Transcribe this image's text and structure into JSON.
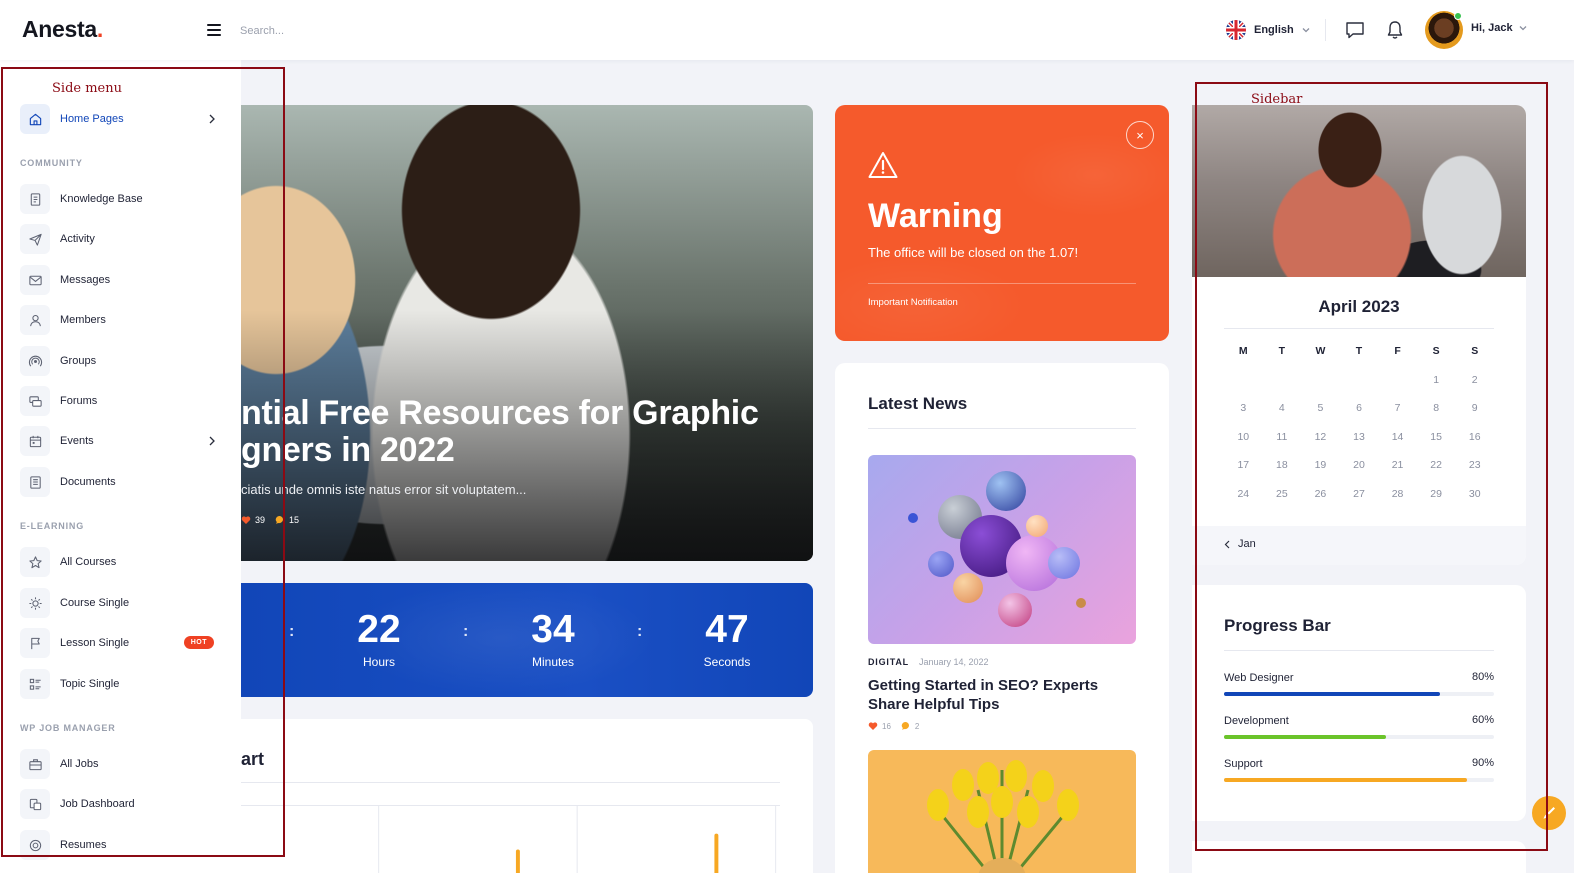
{
  "brand": {
    "name": "Anesta",
    "dot": ".",
    "accent": "#ef4123"
  },
  "header": {
    "search_placeholder": "Search...",
    "language": "English",
    "user_greeting": "Hi, Jack",
    "icons": [
      "menu-icon",
      "flag-uk-icon",
      "chat-icon",
      "bell-icon",
      "avatar"
    ]
  },
  "side_menu": {
    "home": {
      "label": "Home Pages",
      "icon": "home-icon"
    },
    "sections": [
      {
        "title": "COMMUNITY",
        "items": [
          {
            "label": "Knowledge Base",
            "icon": "book-icon"
          },
          {
            "label": "Activity",
            "icon": "send-icon"
          },
          {
            "label": "Messages",
            "icon": "mail-icon"
          },
          {
            "label": "Members",
            "icon": "user-icon"
          },
          {
            "label": "Groups",
            "icon": "groups-icon"
          },
          {
            "label": "Forums",
            "icon": "forums-icon"
          },
          {
            "label": "Events",
            "icon": "calendar-icon",
            "has_arrow": true
          },
          {
            "label": "Documents",
            "icon": "document-icon"
          }
        ]
      },
      {
        "title": "E-LEARNING",
        "items": [
          {
            "label": "All Courses",
            "icon": "star-icon"
          },
          {
            "label": "Course Single",
            "icon": "sun-icon"
          },
          {
            "label": "Lesson Single",
            "icon": "flag-icon",
            "badge": "HOT"
          },
          {
            "label": "Topic Single",
            "icon": "list-icon"
          }
        ]
      },
      {
        "title": "WP JOB MANAGER",
        "items": [
          {
            "label": "All Jobs",
            "icon": "briefcase-icon"
          },
          {
            "label": "Job Dashboard",
            "icon": "dashboard-icon"
          },
          {
            "label": "Resumes",
            "icon": "resume-icon"
          }
        ]
      }
    ]
  },
  "hero": {
    "title_line1": "ntial Free Resources for Graphic",
    "title_line2": "gners in 2022",
    "excerpt": "ciatis unde omnis iste natus error sit voluptatem...",
    "likes": "39",
    "comments": "15"
  },
  "countdown": {
    "hours": "22",
    "hours_label": "Hours",
    "minutes": "34",
    "minutes_label": "Minutes",
    "seconds": "47",
    "seconds_label": "Seconds",
    "separator": ":"
  },
  "chart_card": {
    "title": "art"
  },
  "warning": {
    "title": "Warning",
    "text": "The office will be closed on the 1.07!",
    "footer": "Important Notification",
    "close_glyph": "×",
    "color": "#f55a2c"
  },
  "latest_news": {
    "title": "Latest News",
    "article": {
      "category": "DIGITAL",
      "date": "January 14, 2022",
      "headline": "Getting Started in SEO? Experts Share Helpful Tips",
      "likes": "16",
      "comments": "2"
    }
  },
  "calendar": {
    "month": "April 2023",
    "weekdays": [
      "M",
      "T",
      "W",
      "T",
      "F",
      "S",
      "S"
    ],
    "leading_blanks": 5,
    "days": [
      "1",
      "2",
      "3",
      "4",
      "5",
      "6",
      "7",
      "8",
      "9",
      "10",
      "11",
      "12",
      "13",
      "14",
      "15",
      "16",
      "17",
      "18",
      "19",
      "20",
      "21",
      "22",
      "23",
      "24",
      "25",
      "26",
      "27",
      "28",
      "29",
      "30"
    ],
    "prev_label": "Jan"
  },
  "progress": {
    "title": "Progress Bar",
    "bars": [
      {
        "label": "Web Designer",
        "value": 80,
        "text": "80%",
        "color": "#1146b8"
      },
      {
        "label": "Development",
        "value": 60,
        "text": "60%",
        "color": "#6bc42a"
      },
      {
        "label": "Support",
        "value": 90,
        "text": "90%",
        "color": "#f7a823"
      }
    ]
  },
  "annotations": {
    "side_menu": "Side menu",
    "sidebar": "Sidebar"
  }
}
